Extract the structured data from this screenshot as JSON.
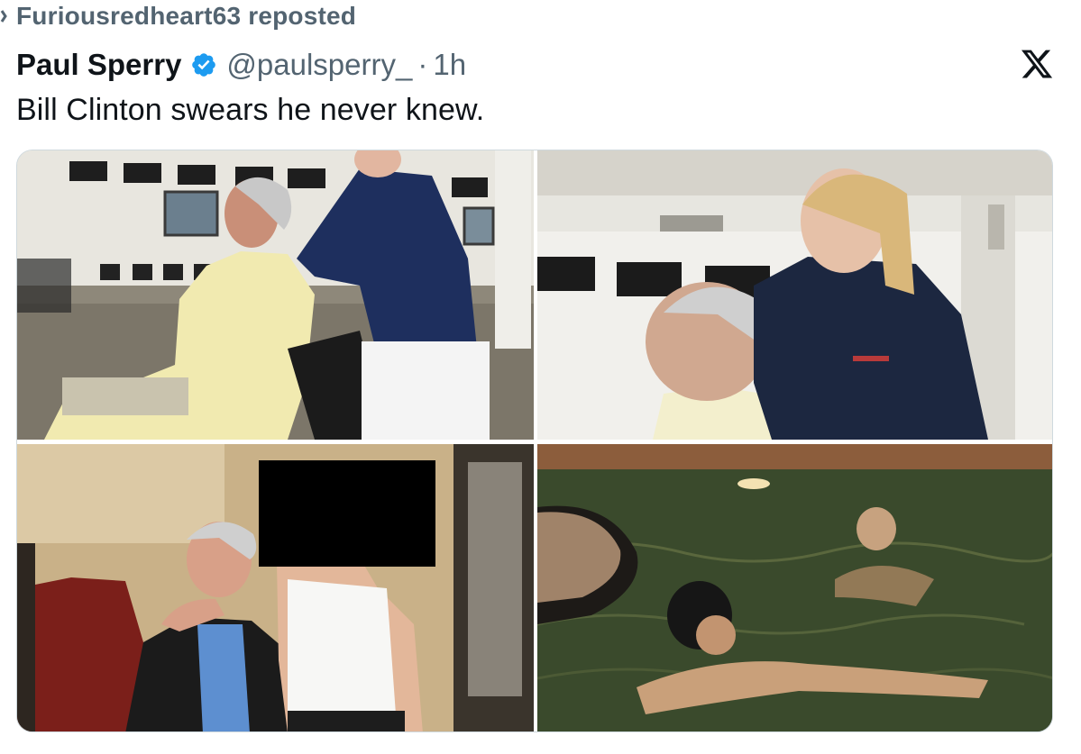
{
  "repost": {
    "text": "Furiousredheart63 reposted",
    "icon": "repost-icon"
  },
  "post": {
    "author_name": "Paul Sperry",
    "handle": "@paulsperry_",
    "separator": "·",
    "time": "1h",
    "verified_icon": "verified-badge-icon",
    "text": "Bill Clinton swears he never knew.",
    "platform_icon": "x-logo-icon"
  },
  "media": {
    "photos": [
      {
        "name": "photo-1",
        "description_icon": "photo-icon"
      },
      {
        "name": "photo-2",
        "description_icon": "photo-icon"
      },
      {
        "name": "photo-3",
        "description_icon": "photo-icon"
      },
      {
        "name": "photo-4",
        "description_icon": "photo-icon"
      }
    ]
  },
  "colors": {
    "secondary_text": "#536471",
    "primary_text": "#0f1419",
    "verified_blue": "#1d9bf0"
  }
}
